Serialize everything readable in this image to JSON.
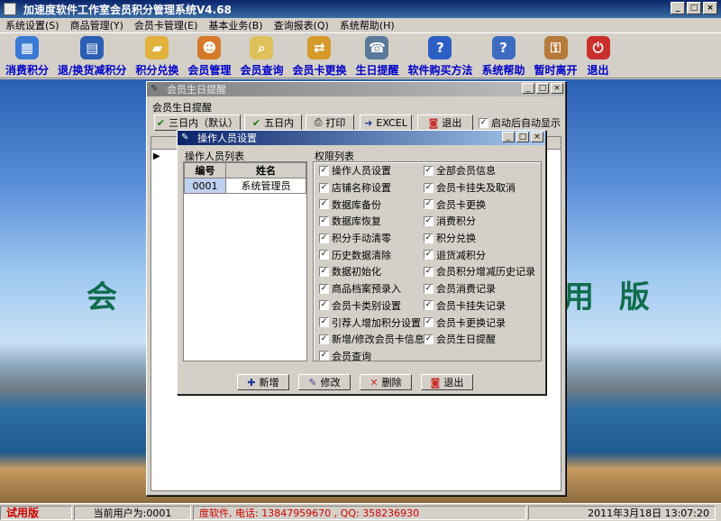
{
  "app": {
    "title": "加速度软件工作室会员积分管理系统V4.68"
  },
  "menu": [
    "系统设置(S)",
    "商品管理(Y)",
    "会员卡管理(E)",
    "基本业务(B)",
    "查询报表(Q)",
    "系统帮助(H)"
  ],
  "toolbar": [
    {
      "label": "消费积分",
      "icon": "calculator-icon",
      "color": "#3a7ad5"
    },
    {
      "label": "退/换货减积分",
      "icon": "document-return-icon",
      "color": "#2a5fb3"
    },
    {
      "label": "积分兑换",
      "icon": "folder-icon",
      "color": "#e2b13c"
    },
    {
      "label": "会员管理",
      "icon": "users-icon",
      "color": "#d47a2a"
    },
    {
      "label": "会员查询",
      "icon": "search-card-icon",
      "color": "#e0c05a"
    },
    {
      "label": "会员卡更换",
      "icon": "card-exchange-icon",
      "color": "#d59a2a"
    },
    {
      "label": "生日提醒",
      "icon": "phone-icon",
      "color": "#5a7a9a"
    },
    {
      "label": "软件购买方法",
      "icon": "help-icon",
      "color": "#2c5fc4"
    },
    {
      "label": "系统帮助",
      "icon": "help-book-icon",
      "color": "#3d6bbf"
    },
    {
      "label": "暂时离开",
      "icon": "key-icon",
      "color": "#b67a3a"
    },
    {
      "label": "退出",
      "icon": "exit-icon",
      "color": "#c9302c"
    }
  ],
  "background_text": {
    "left": "会",
    "right": "用 版"
  },
  "birthday_window": {
    "title": "会员生日提醒",
    "group_label": "会员生日提醒",
    "buttons": [
      "三日内（默认）",
      "五日内",
      "打印",
      "EXCEL",
      "退出"
    ],
    "autoshow_label": "启动后自动显示"
  },
  "operator_window": {
    "title": "操作人员设置",
    "list_label": "操作人员列表",
    "columns": [
      "编号",
      "姓名"
    ],
    "rows": [
      [
        "0001",
        "系统管理员"
      ]
    ],
    "perm_label": "权限列表",
    "permissions_left": [
      "操作人员设置",
      "店铺名称设置",
      "数据库备份",
      "数据库恢复",
      "积分手动清零",
      "历史数据清除",
      "数据初始化",
      "商品档案预录入",
      "会员卡类别设置",
      "引荐人增加积分设置",
      "新增/修改会员卡信息",
      "会员查询"
    ],
    "permissions_right": [
      "全部会员信息",
      "会员卡挂失及取消",
      "会员卡更换",
      "消费积分",
      "积分兑换",
      "退货减积分",
      "会员积分增减历史记录",
      "会员消费记录",
      "会员卡挂失记录",
      "会员卡更换记录",
      "会员生日提醒"
    ],
    "buttons": [
      "新增",
      "修改",
      "删除",
      "退出"
    ]
  },
  "status": {
    "trial": "试用版",
    "user": "当前用户为:0001",
    "contact": "度软件, 电话: 13847959670 , QQ: 358236930",
    "datetime": "2011年3月18日  13:07:20"
  }
}
